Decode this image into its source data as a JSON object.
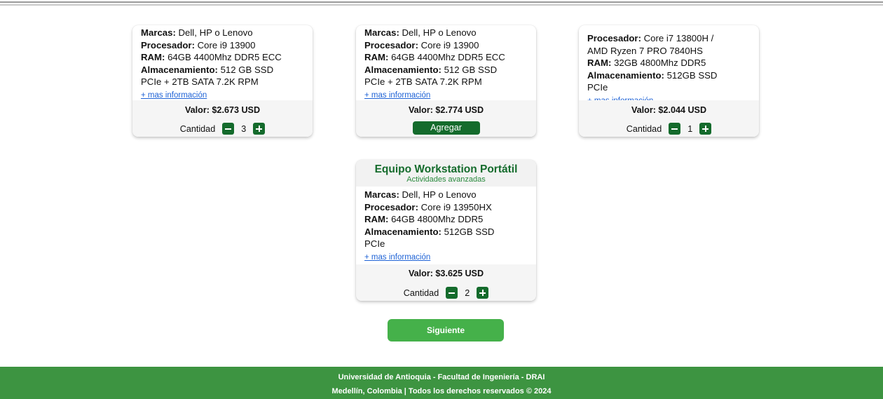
{
  "cards": [
    {
      "specs": [
        {
          "label": "Marcas:",
          "value": " Dell, HP o Lenovo"
        },
        {
          "label": "Procesador:",
          "value": " Core i9 13900"
        },
        {
          "label": "RAM:",
          "value": " 64GB 4400Mhz DDR5 ECC"
        },
        {
          "label": "Almacenamiento:",
          "value": " 512 GB SSD"
        },
        {
          "label": "",
          "value": "PCIe + 2TB SATA 7.2K RPM"
        }
      ],
      "more_link": "+ mas información",
      "price": "Valor: $2.673 USD",
      "quantity_label": "Cantidad",
      "quantity": "3"
    },
    {
      "specs": [
        {
          "label": "Marcas:",
          "value": " Dell, HP o Lenovo"
        },
        {
          "label": "Procesador:",
          "value": " Core i9 13900"
        },
        {
          "label": "RAM:",
          "value": " 64GB 4400Mhz DDR5 ECC"
        },
        {
          "label": "Almacenamiento:",
          "value": " 512 GB SSD"
        },
        {
          "label": "",
          "value": "PCIe + 2TB SATA 7.2K RPM"
        }
      ],
      "more_link": "+ mas información",
      "price": "Valor: $2.774 USD",
      "add_label": "Agregar"
    },
    {
      "specs": [
        {
          "label": "Procesador:",
          "value": " Core i7 13800H /"
        },
        {
          "label": "",
          "value": "AMD Ryzen 7 PRO 7840HS"
        },
        {
          "label": "RAM:",
          "value": " 32GB 4800Mhz DDR5"
        },
        {
          "label": "Almacenamiento:",
          "value": " 512GB SSD"
        },
        {
          "label": "",
          "value": "PCIe"
        }
      ],
      "more_link": "+ mas información",
      "price": "Valor: $2.044 USD",
      "quantity_label": "Cantidad",
      "quantity": "1"
    },
    {
      "title": "Equipo Workstation Portátil",
      "subtitle": "Actividades avanzadas",
      "specs": [
        {
          "label": "Marcas:",
          "value": " Dell, HP o Lenovo"
        },
        {
          "label": "Procesador:",
          "value": " Core i9 13950HX"
        },
        {
          "label": "RAM:",
          "value": " 64GB 4800Mhz DDR5"
        },
        {
          "label": "Almacenamiento:",
          "value": " 512GB SSD"
        },
        {
          "label": "",
          "value": "PCIe"
        }
      ],
      "more_link": "+ mas información",
      "price": "Valor: $3.625 USD",
      "quantity_label": "Cantidad",
      "quantity": "2"
    }
  ],
  "next_button": "Siguiente",
  "footer": {
    "line1": "Universidad de Antioquia - Facultad de Ingeniería - DRAI",
    "line2": "Medellín, Colombia | Todos los derechos reservados © 2024"
  },
  "colors": {
    "primary_green": "#146b2c",
    "button_green": "#45b14a",
    "footer_green": "#3d9441",
    "link_blue": "#1f63d6"
  }
}
